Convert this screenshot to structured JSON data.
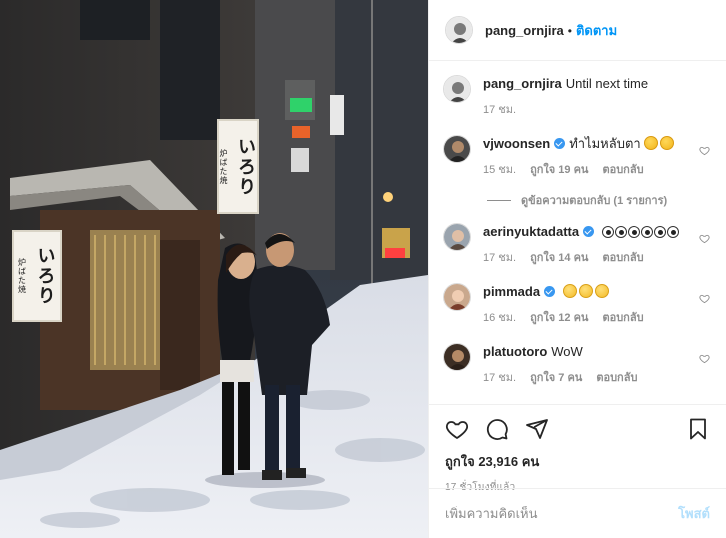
{
  "photo": {
    "alt": "",
    "sign_small": "炉ばた焼",
    "sign_big": "いろり"
  },
  "header": {
    "username": "pang_ornjira",
    "separator": "•",
    "follow_label": "ติดตาม"
  },
  "caption": {
    "username": "pang_ornjira",
    "text": "Until next time",
    "time": "17 ชม."
  },
  "comments": [
    {
      "username": "vjwoonsen",
      "verified": true,
      "text": "ทำไมหลับตา",
      "emojis": [
        "rofl",
        "rofl"
      ],
      "time": "15 ชม.",
      "likes": "ถูกใจ 19 คน",
      "reply": "ตอบกลับ",
      "view_replies": "ดูข้อความตอบกลับ (1 รายการ)"
    },
    {
      "username": "aerinyuktadatta",
      "verified": true,
      "text": "",
      "emojis": [
        "eye",
        "eye",
        "eye",
        "eye",
        "eye",
        "eye"
      ],
      "time": "17 ชม.",
      "likes": "ถูกใจ 14 คน",
      "reply": "ตอบกลับ"
    },
    {
      "username": "pimmada",
      "verified": true,
      "text": "",
      "emojis": [
        "think",
        "think",
        "think"
      ],
      "time": "16 ชม.",
      "likes": "ถูกใจ 12 คน",
      "reply": "ตอบกลับ"
    },
    {
      "username": "platuotoro",
      "verified": false,
      "text": "WoW",
      "emojis": [],
      "time": "17 ชม.",
      "likes": "ถูกใจ 7 คน",
      "reply": "ตอบกลับ"
    }
  ],
  "icons": {
    "like": "heart-icon",
    "comment": "comment-icon",
    "share": "share-icon",
    "save": "bookmark-icon"
  },
  "likes_text": "ถูกใจ 23,916 คน",
  "posted_time": "17 ชั่วโมงที่แล้ว",
  "add_comment": {
    "placeholder": "เพิ่มความคิดเห็น",
    "post_label": "โพสต์"
  },
  "colors": {
    "link_blue": "#0095f6",
    "post_disabled": "#b2dffc",
    "muted": "#8e8e8e",
    "verified": "#3897f0"
  }
}
